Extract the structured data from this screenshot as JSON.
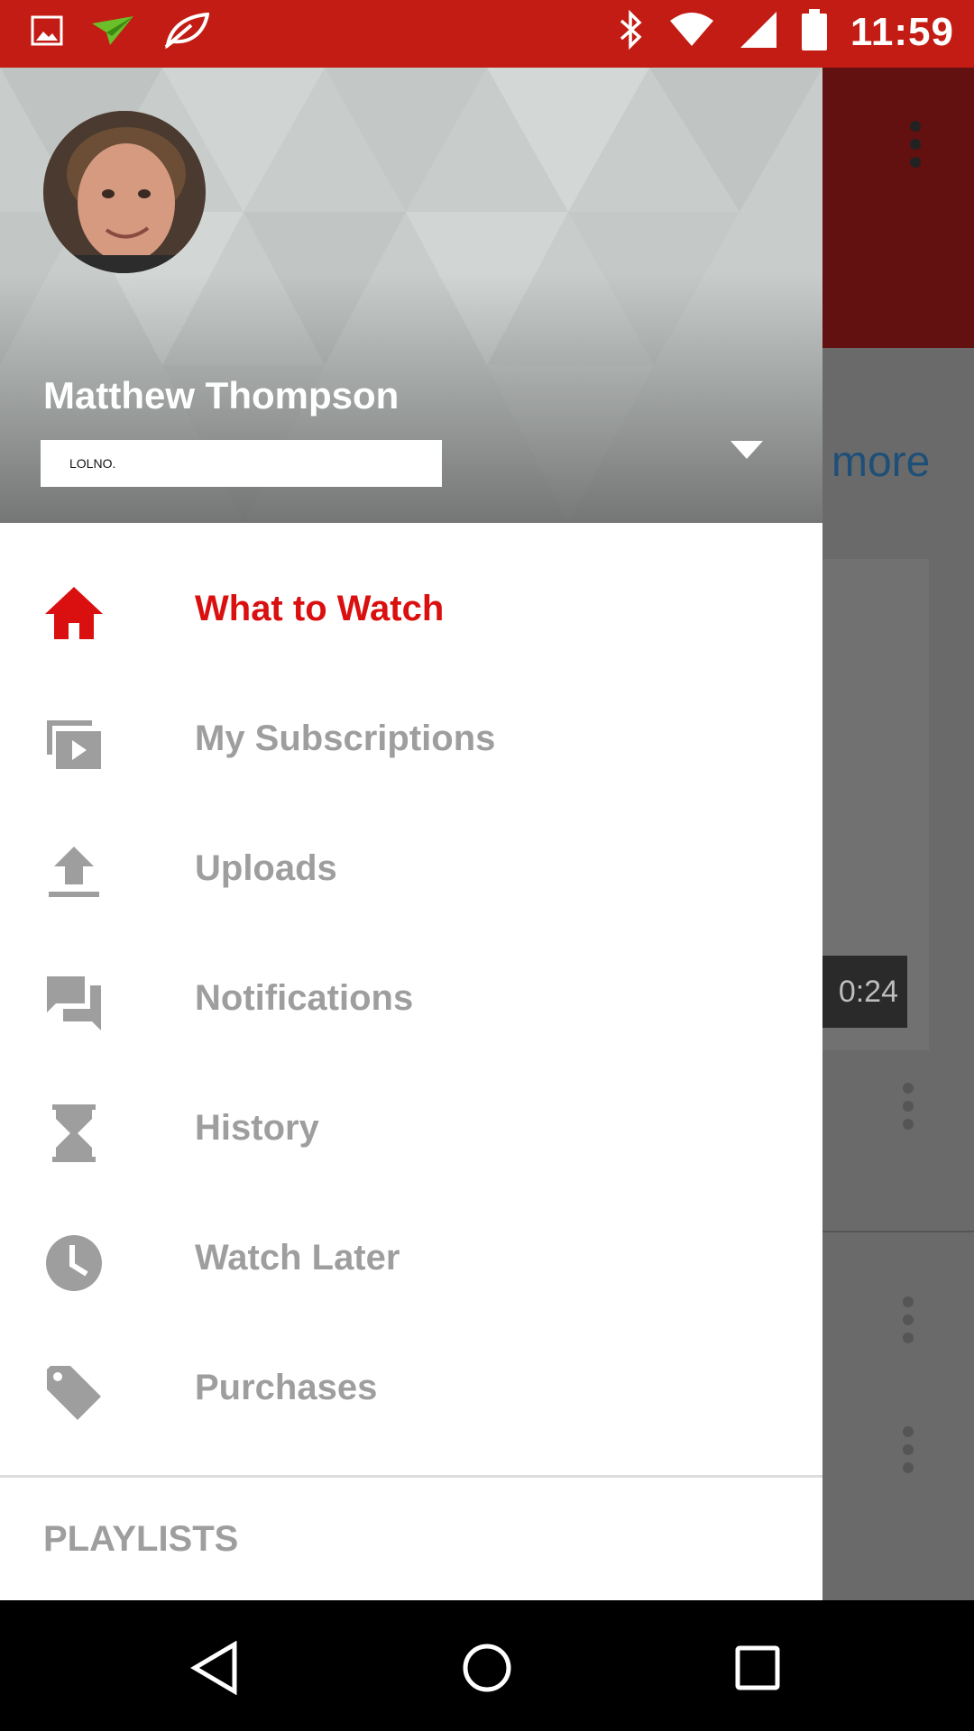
{
  "status_bar": {
    "time": "11:59",
    "left_icons": [
      "gallery-icon",
      "paper-plane-icon",
      "leaf-icon"
    ],
    "right_icons": [
      "bluetooth-icon",
      "wifi-icon",
      "cell-signal-icon",
      "battery-icon"
    ]
  },
  "background_app": {
    "more_link": "more",
    "video_duration": "0:24"
  },
  "drawer": {
    "user_name": "Matthew Thompson",
    "account_label": "LOLNO.",
    "menu": [
      {
        "label": "What to Watch",
        "icon": "home-icon",
        "active": true
      },
      {
        "label": "My Subscriptions",
        "icon": "subscriptions-icon",
        "active": false
      },
      {
        "label": "Uploads",
        "icon": "upload-icon",
        "active": false
      },
      {
        "label": "Notifications",
        "icon": "chat-icon",
        "active": false
      },
      {
        "label": "History",
        "icon": "hourglass-icon",
        "active": false
      },
      {
        "label": "Watch Later",
        "icon": "clock-icon",
        "active": false
      },
      {
        "label": "Purchases",
        "icon": "tag-icon",
        "active": false
      }
    ],
    "section_title": "PLAYLISTS"
  },
  "nav_bar": {
    "buttons": [
      "back-icon",
      "home-circle-icon",
      "recents-icon"
    ]
  },
  "colors": {
    "status_bar": "#c31c14",
    "active": "#d9100f",
    "inactive": "#9e9e9e"
  }
}
